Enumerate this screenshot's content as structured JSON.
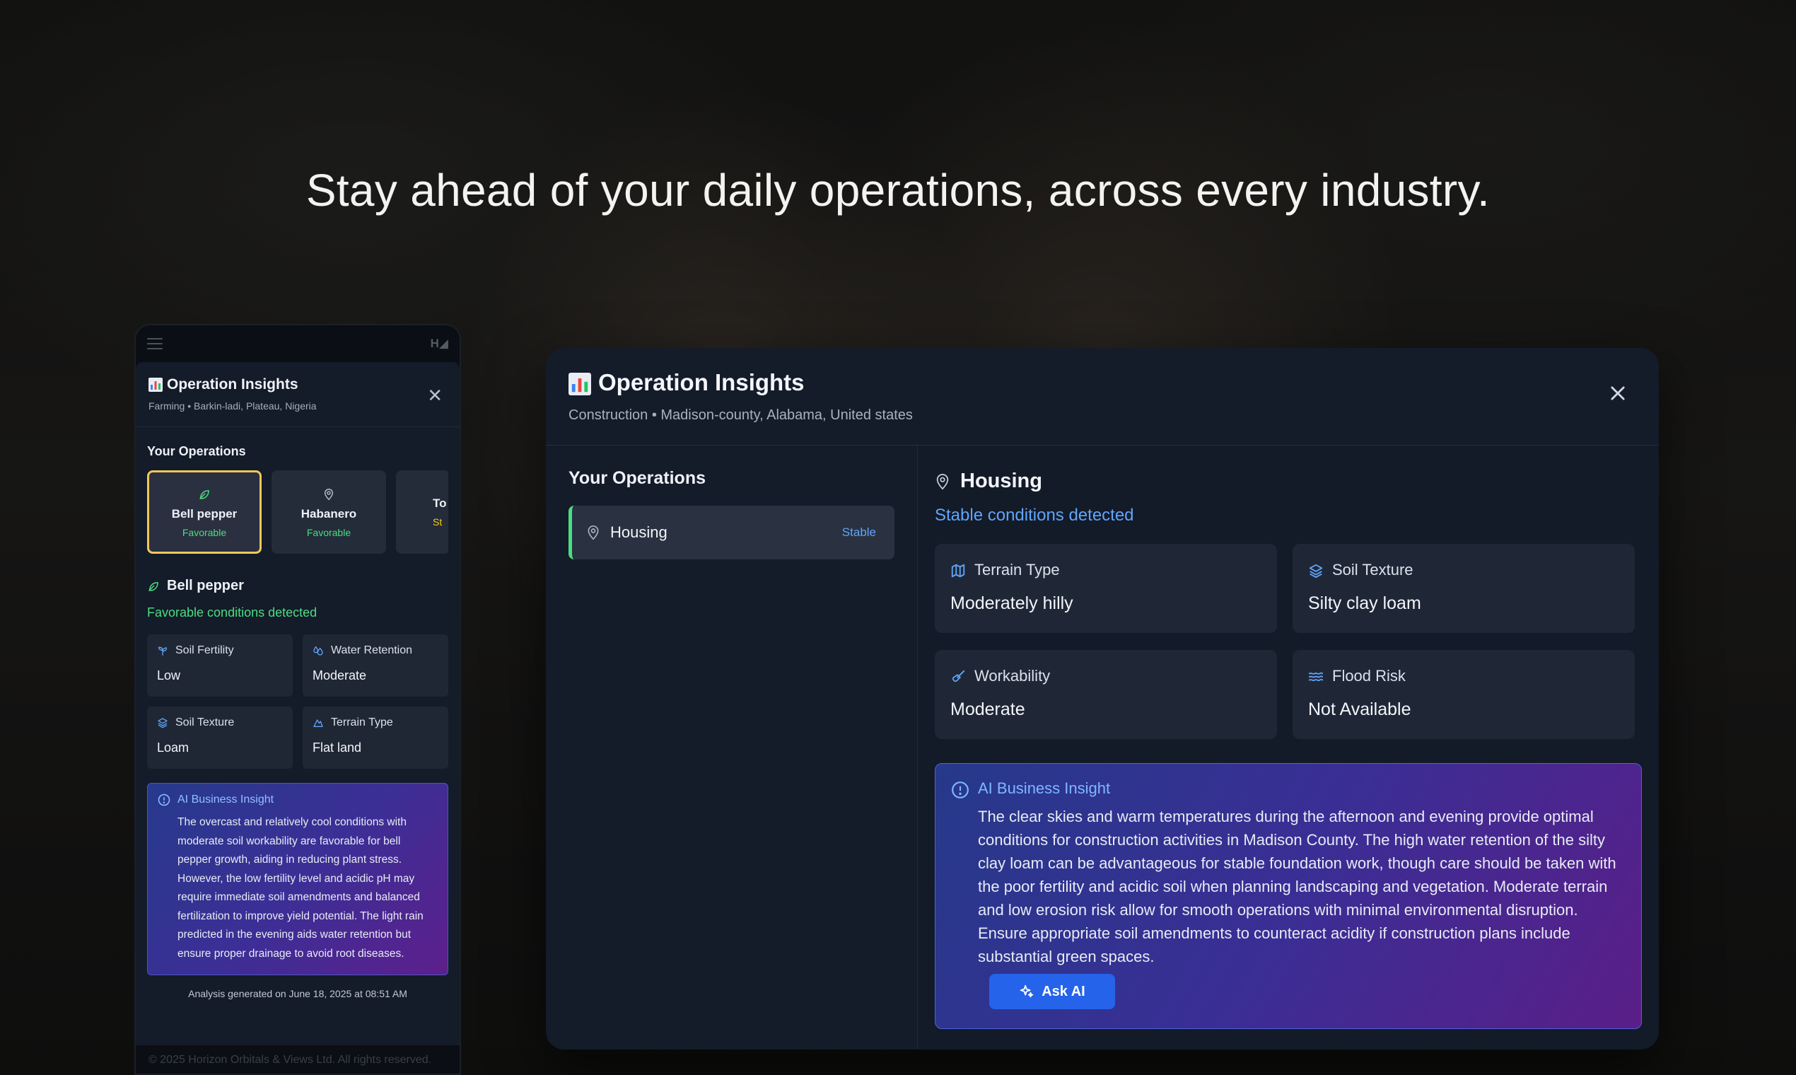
{
  "headline": "Stay ahead of your daily operations, across every industry.",
  "phone": {
    "brand": "H◢",
    "modal": {
      "title": "Operation Insights",
      "subtitle": "Farming • Barkin-ladi, Plateau, Nigeria",
      "section_title": "Your Operations",
      "operations": [
        {
          "name": "Bell pepper",
          "status": "Favorable",
          "icon": "leaf-icon",
          "selected": true
        },
        {
          "name": "Habanero",
          "status": "Favorable",
          "icon": "map-pin-icon"
        },
        {
          "name": "To",
          "status": "St",
          "icon": "",
          "partial": true
        }
      ],
      "detail": {
        "title": "Bell pepper",
        "subtitle": "Favorable conditions detected",
        "metrics": [
          {
            "label": "Soil Fertility",
            "value": "Low",
            "icon": "sprout-icon"
          },
          {
            "label": "Water Retention",
            "value": "Moderate",
            "icon": "droplets-icon"
          },
          {
            "label": "Soil Texture",
            "value": "Loam",
            "icon": "layers-icon"
          },
          {
            "label": "Terrain Type",
            "value": "Flat land",
            "icon": "mountain-icon"
          }
        ]
      },
      "ai_insight": {
        "title": "AI Business Insight",
        "text": "The overcast and relatively cool conditions with moderate soil workability are favorable for bell pepper growth, aiding in reducing plant stress. However, the low fertility level and acidic pH may require immediate soil amendments and balanced fertilization to improve yield potential. The light rain predicted in the evening aids water retention but ensure proper drainage to avoid root diseases."
      },
      "footer": "Analysis generated on June 18, 2025 at 08:51 AM"
    },
    "copyright": "© 2025 Horizon Orbitals & Views Ltd. All rights reserved."
  },
  "modal": {
    "title": "Operation Insights",
    "subtitle": "Construction • Madison-county, Alabama, United states",
    "left": {
      "title": "Your Operations",
      "operations": [
        {
          "name": "Housing",
          "status": "Stable",
          "icon": "map-pin-icon"
        }
      ]
    },
    "detail": {
      "title": "Housing",
      "subtitle": "Stable conditions detected",
      "metrics": [
        {
          "label": "Terrain Type",
          "value": "Moderately hilly",
          "icon": "map-icon"
        },
        {
          "label": "Soil Texture",
          "value": "Silty clay loam",
          "icon": "layers-icon"
        },
        {
          "label": "Workability",
          "value": "Moderate",
          "icon": "shovel-icon"
        },
        {
          "label": "Flood Risk",
          "value": "Not Available",
          "icon": "waves-icon"
        }
      ]
    },
    "ai_insight": {
      "title": "AI Business Insight",
      "text": "The clear skies and warm temperatures during the afternoon and evening provide optimal conditions for construction activities in Madison County. The high water retention of the silty clay loam can be advantageous for stable foundation work, though care should be taken with the poor fertility and acidic soil when planning landscaping and vegetation. Moderate terrain and low erosion risk allow for smooth operations with minimal environmental disruption. Ensure appropriate soil amendments to counteract acidity if construction plans include substantial green spaces.",
      "button_label": "Ask AI"
    }
  },
  "colors": {
    "accent_blue": "#60a5fa",
    "accent_green": "#4ade80",
    "selected_border": "#f1c75a",
    "button": "#2563eb"
  }
}
